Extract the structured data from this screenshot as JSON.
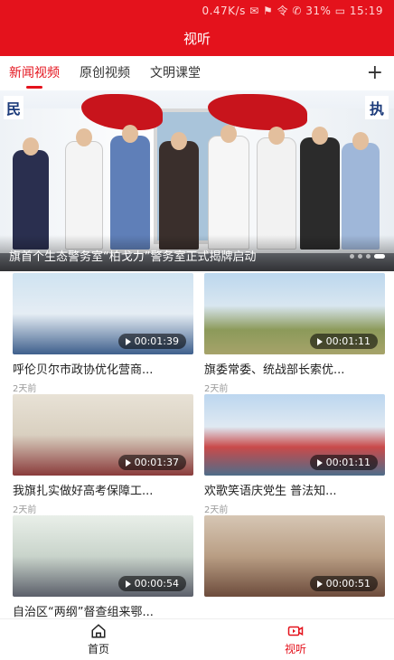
{
  "status_bar": {
    "text": "0.47K/s  ✉ ⚑ 令 ✆ 31% ▭ 15:19"
  },
  "header": {
    "title": "视听"
  },
  "tabs": [
    {
      "label": "新闻视频",
      "active": true
    },
    {
      "label": "原创视频",
      "active": false
    },
    {
      "label": "文明课堂",
      "active": false
    }
  ],
  "banner": {
    "caption": "旗首个生态警务室“柏戈力”警务室正式揭牌启动",
    "sign_left": "民",
    "sign_right": "执"
  },
  "videos": [
    {
      "title": "呼伦贝尔市政协优化营商...",
      "time": "2天前",
      "duration": "00:01:39"
    },
    {
      "title": "旗委常委、统战部长索优...",
      "time": "2天前",
      "duration": "00:01:11"
    },
    {
      "title": "我旗扎实做好高考保障工...",
      "time": "2天前",
      "duration": "00:01:37"
    },
    {
      "title": "欢歌笑语庆党生 普法知...",
      "time": "2天前",
      "duration": "00:01:11"
    },
    {
      "title": "自治区“两纲”督查组来鄂...",
      "time": "",
      "duration": "00:00:54"
    },
    {
      "title": "",
      "time": "",
      "duration": "00:00:51"
    }
  ],
  "bottom_nav": [
    {
      "label": "首页",
      "icon": "home-icon",
      "active": false
    },
    {
      "label": "视听",
      "icon": "video-icon",
      "active": true
    }
  ],
  "colors": {
    "brand": "#e4121c"
  }
}
